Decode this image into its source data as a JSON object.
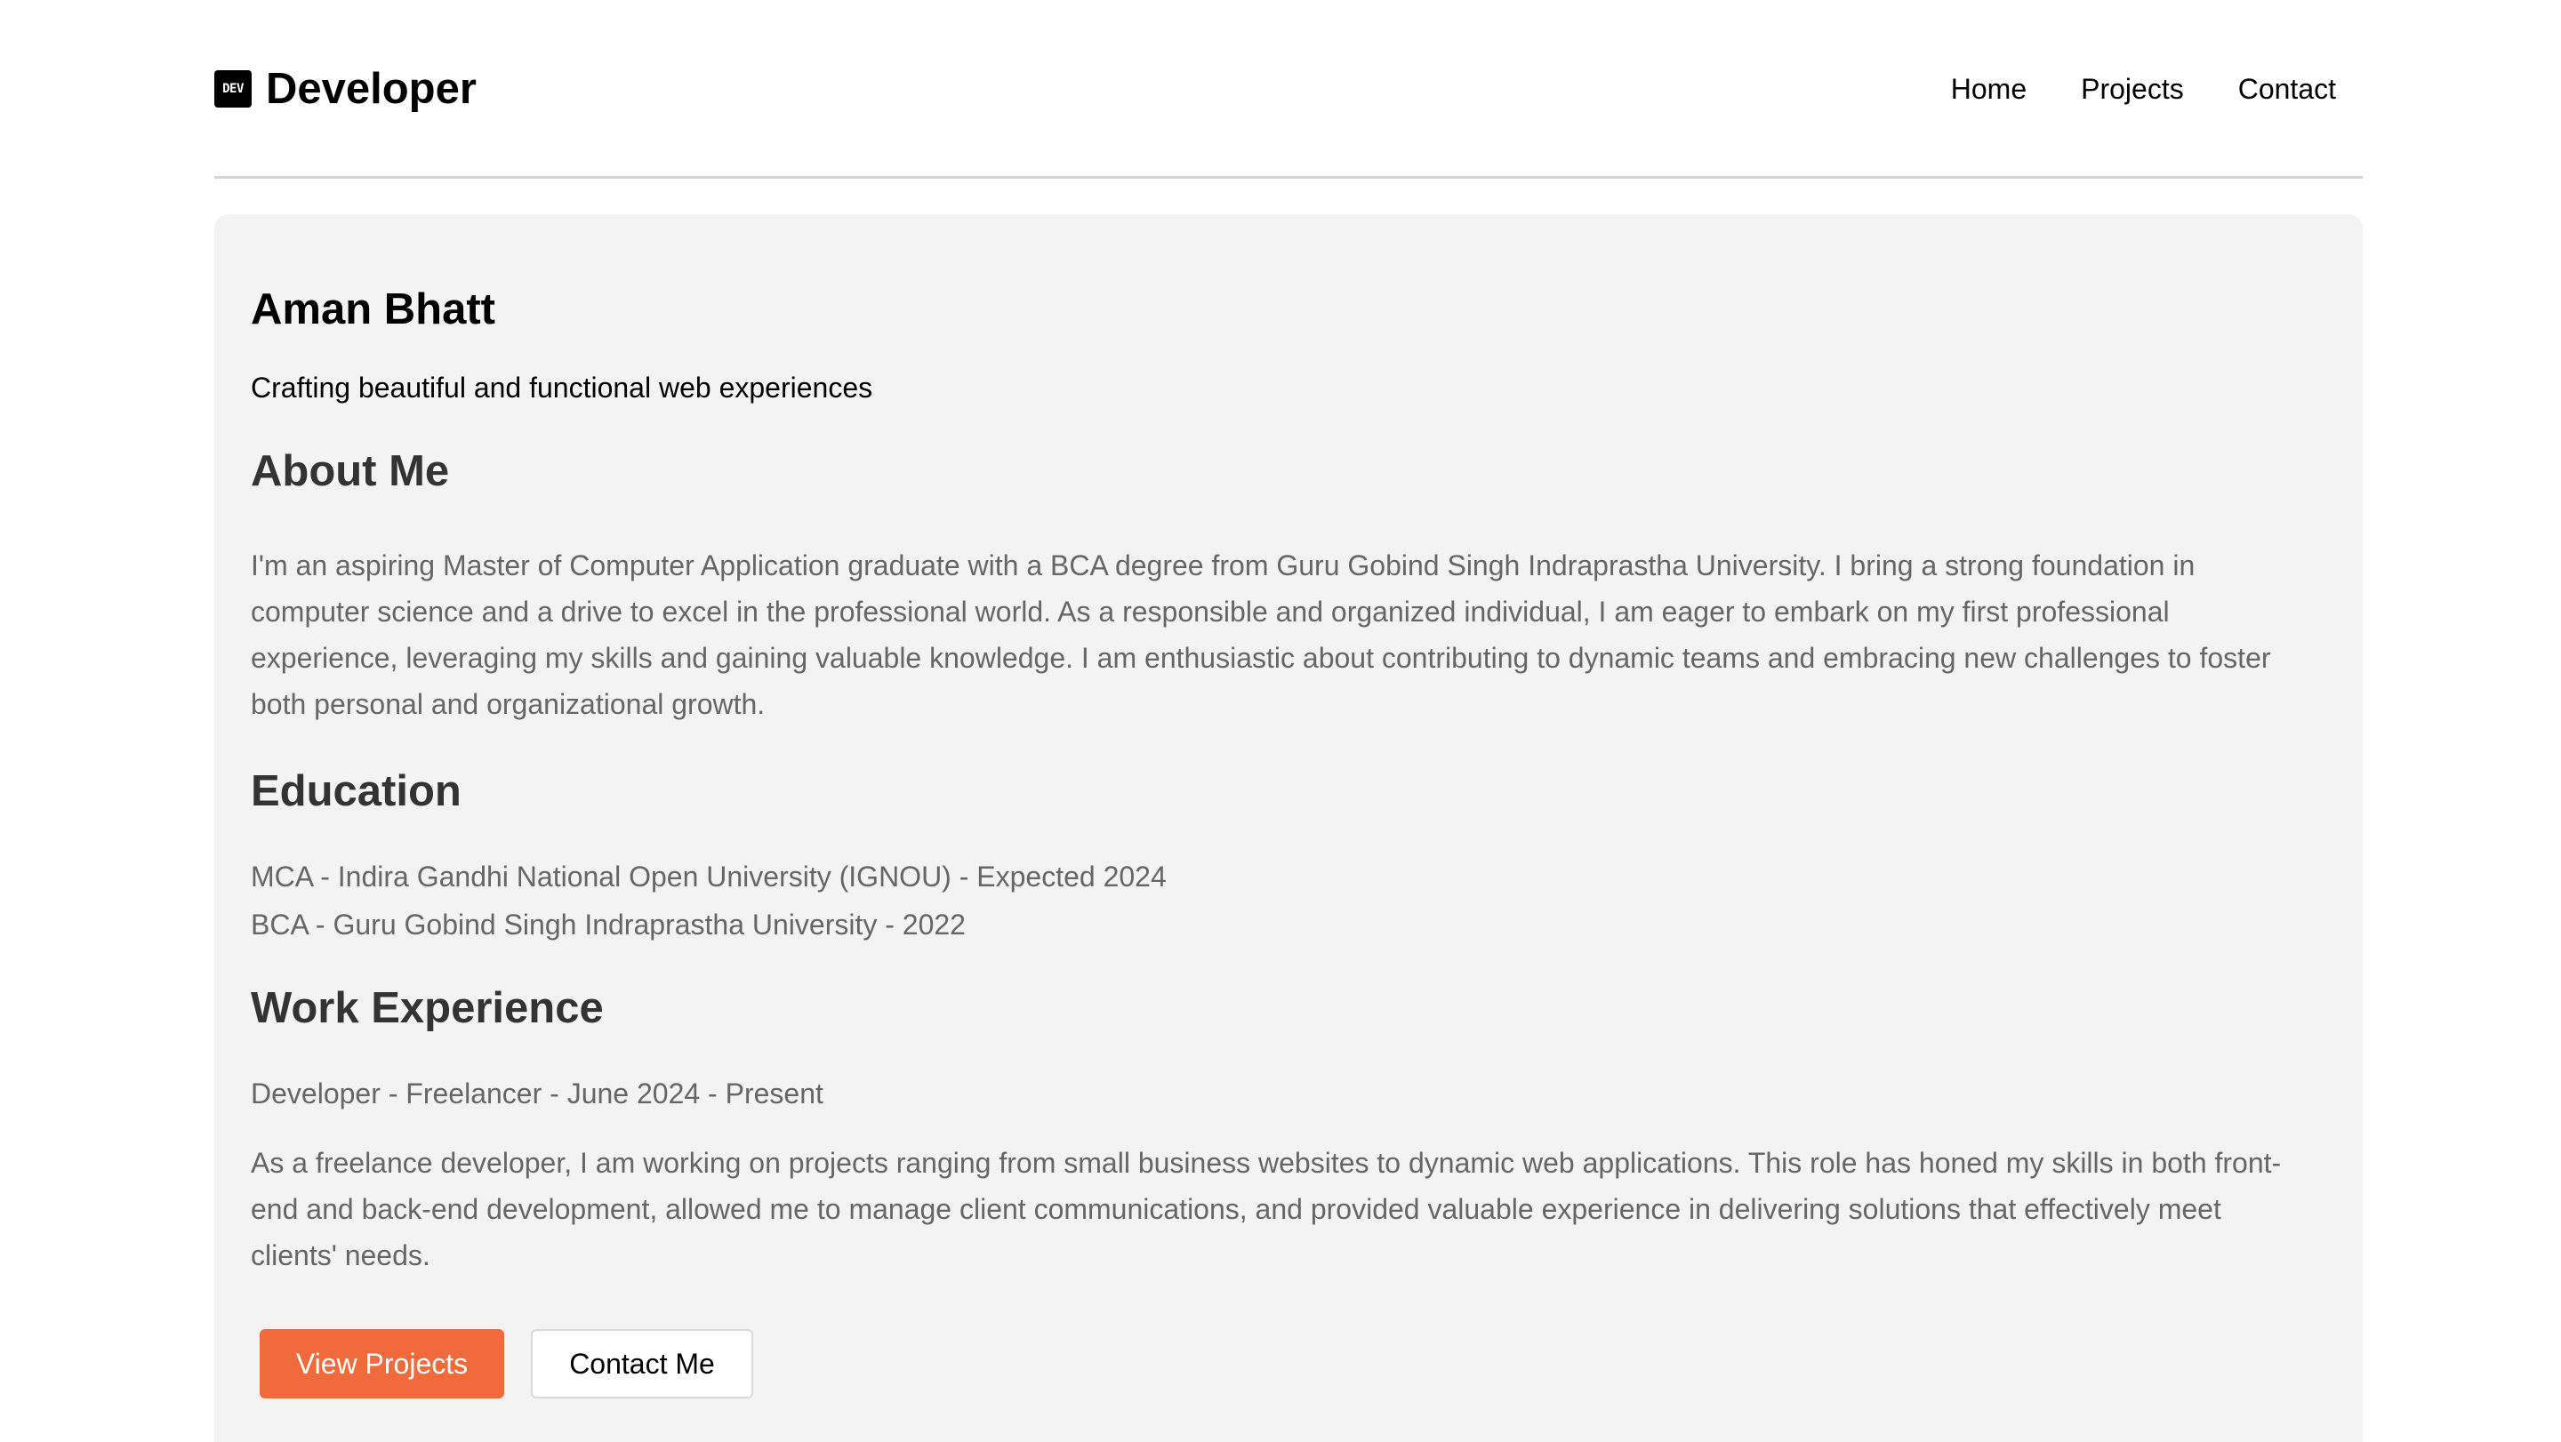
{
  "header": {
    "logo_text": "DEV",
    "brand": "Developer",
    "nav": [
      "Home",
      "Projects",
      "Contact"
    ]
  },
  "profile": {
    "name": "Aman Bhatt",
    "tagline": "Crafting beautiful and functional web experiences"
  },
  "about": {
    "title": "About Me",
    "text": "I'm an aspiring Master of Computer Application graduate with a BCA degree from Guru Gobind Singh Indraprastha University. I bring a strong foundation in computer science and a drive to excel in the professional world. As a responsible and organized individual, I am eager to embark on my first professional experience, leveraging my skills and gaining valuable knowledge. I am enthusiastic about contributing to dynamic teams and embracing new challenges to foster both personal and organizational growth."
  },
  "education": {
    "title": "Education",
    "items": [
      "MCA - Indira Gandhi National Open University (IGNOU) - Expected 2024",
      "BCA - Guru Gobind Singh Indraprastha University - 2022"
    ]
  },
  "work": {
    "title": "Work Experience",
    "role": "Developer - Freelancer - June 2024 - Present",
    "description": "As a freelance developer, I am working on projects ranging from small business websites to dynamic web applications. This role has honed my skills in both front-end and back-end development, allowed me to manage client communications, and provided valuable experience in delivering solutions that effectively meet clients' needs."
  },
  "buttons": {
    "primary": "View Projects",
    "secondary": "Contact Me"
  },
  "colors": {
    "accent": "#f06a3c",
    "card_bg": "#f3f3f3",
    "heading": "#333333",
    "body_text": "#666666"
  }
}
